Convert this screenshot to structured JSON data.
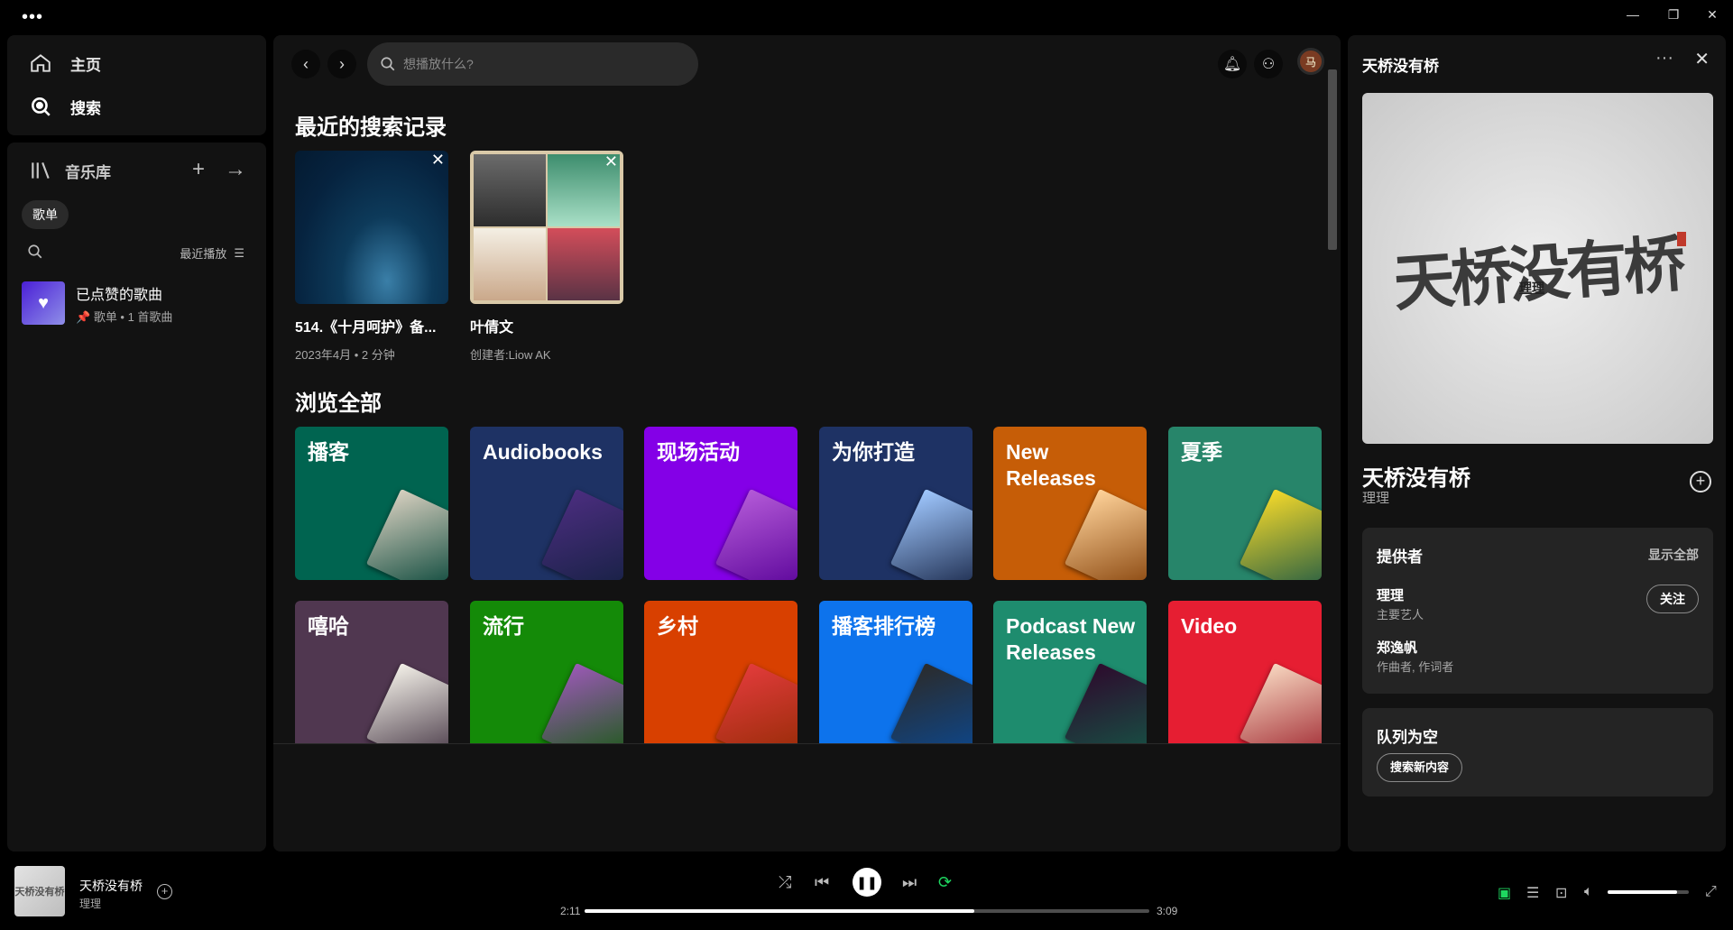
{
  "nav": {
    "home": "主页",
    "search": "搜索"
  },
  "library": {
    "title": "音乐库",
    "add_icon": "plus-icon",
    "expand_icon": "arrow-right-icon",
    "filter_chip": "歌单",
    "sort_label": "最近播放",
    "items": [
      {
        "title": "已点赞的歌曲",
        "pin": "📌",
        "subtitle": "歌单 • 1 首歌曲"
      }
    ]
  },
  "search": {
    "placeholder": "想播放什么?",
    "value": ""
  },
  "avatar": {
    "letter": "马"
  },
  "recent": {
    "title": "最近的搜索记录",
    "items": [
      {
        "title": "514.《十月呵护》备...",
        "subtitle": "2023年4月 • 2 分钟"
      },
      {
        "title": "叶倩文",
        "subtitle": "创建者:Liow AK"
      }
    ]
  },
  "browse": {
    "title": "浏览全部",
    "genres": [
      {
        "label": "播客",
        "color": "#006450",
        "art": "#d8d0c0"
      },
      {
        "label": "Audiobooks",
        "color": "#1e3264",
        "art": "#4b2d7f"
      },
      {
        "label": "现场活动",
        "color": "#8400e7",
        "art": "#b45ad8"
      },
      {
        "label": "为你打造",
        "color": "#1e3264",
        "art": "#a0c8ff"
      },
      {
        "label": "New Releases",
        "color": "#c65d07",
        "art": "#ffd39a"
      },
      {
        "label": "夏季",
        "color": "#27856a",
        "art": "#f5d92a"
      },
      {
        "label": "嘻哈",
        "color": "#503750",
        "art": "#f3f0e8"
      },
      {
        "label": "流行",
        "color": "#148a08",
        "art": "#9b59b6"
      },
      {
        "label": "乡村",
        "color": "#d84000",
        "art": "#e23b3b"
      },
      {
        "label": "播客排行榜",
        "color": "#0d73ec",
        "art": "#2b2b2b"
      },
      {
        "label": "Podcast New Releases",
        "color": "#1e8c6e",
        "art": "#2d0b2d"
      },
      {
        "label": "Video",
        "color": "#e61e32",
        "art": "#f7d7c0"
      }
    ]
  },
  "right_panel": {
    "header": "天桥没有桥",
    "cover_text": "天桥没有桥",
    "cover_sub": "理理",
    "song": "天桥没有桥",
    "artist": "理理",
    "credits": {
      "title": "提供者",
      "show_all": "显示全部",
      "people": [
        {
          "name": "理理",
          "role": "主要艺人",
          "follow": "关注"
        },
        {
          "name": "郑逸帆",
          "role": "作曲者, 作词者"
        }
      ]
    },
    "queue": {
      "title": "队列为空",
      "button": "搜索新内容"
    }
  },
  "player": {
    "title": "天桥没有桥",
    "artist": "理理",
    "cover_text": "天桥没有桥",
    "elapsed": "2:11",
    "duration": "3:09",
    "progress": 0.69,
    "volume": 0.85
  }
}
